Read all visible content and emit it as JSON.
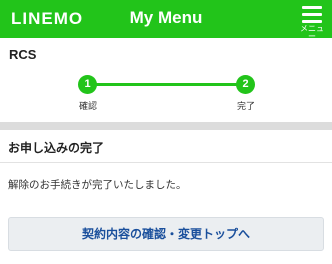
{
  "header": {
    "logo": "LINEMO",
    "title": "My Menu",
    "menu_label": "メニュー"
  },
  "service": {
    "name": "RCS"
  },
  "steps": [
    {
      "number": "1",
      "label": "確認"
    },
    {
      "number": "2",
      "label": "完了"
    }
  ],
  "completion": {
    "title": "お申し込みの完了",
    "message": "解除のお手続きが完了いたしました。",
    "button_label": "契約内容の確認・変更トップへ"
  },
  "colors": {
    "brand_green": "#22c41a",
    "link_blue": "#1a4f9c"
  }
}
